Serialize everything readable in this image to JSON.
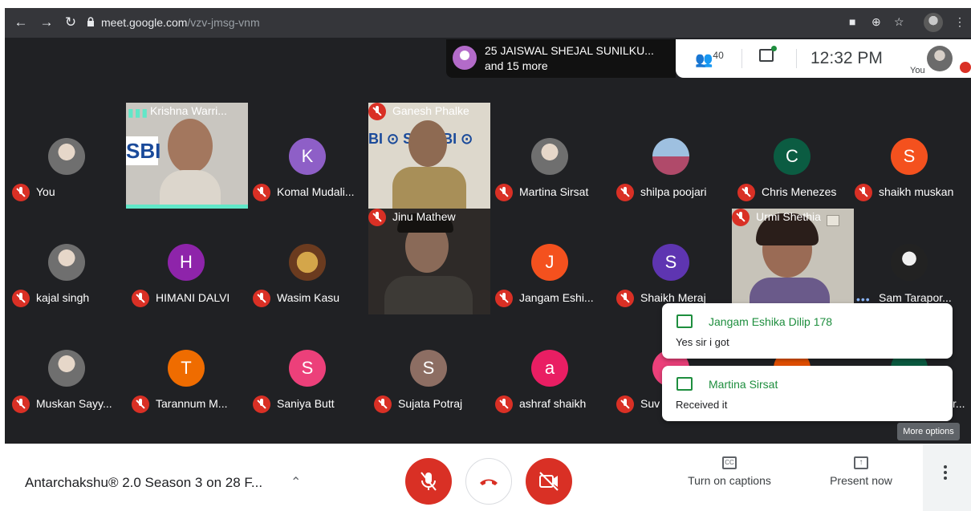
{
  "browser": {
    "url_host": "meet.google.com",
    "url_path": "/vzv-jmsg-vnm"
  },
  "topbar": {
    "presenter_line1": "25 JAISWAL SHEJAL SUNILKU...",
    "presenter_line2": "and 15 more",
    "participant_count": "40",
    "time": "12:32 PM",
    "you_label": "You"
  },
  "tiles": [
    {
      "label": "You"
    },
    {
      "label": "Krishna Warri..."
    },
    {
      "label": "Komal Mudali...",
      "initial": "K",
      "color": "#8e5fc7"
    },
    {
      "label": "Ganesh Phalke"
    },
    {
      "label": "Martina Sirsat"
    },
    {
      "label": "shilpa poojari"
    },
    {
      "label": "Chris Menezes",
      "initial": "C",
      "color": "#0b5c42"
    },
    {
      "label": "shaikh muskan",
      "initial": "S",
      "color": "#f4511e"
    },
    {
      "label": "kajal singh"
    },
    {
      "label": "HIMANI DALVI",
      "initial": "H",
      "color": "#8e24aa"
    },
    {
      "label": "Wasim Kasu"
    },
    {
      "label": "Jinu Mathew"
    },
    {
      "label": "Jangam Eshi...",
      "initial": "J",
      "color": "#f4511e"
    },
    {
      "label": "Shaikh Meraj",
      "initial": "S",
      "color": "#5e35b1"
    },
    {
      "label": "Urmi Shethia"
    },
    {
      "label": "Sam Tarapor..."
    },
    {
      "label": "Muskan Sayy..."
    },
    {
      "label": "Tarannum M...",
      "initial": "T",
      "color": "#ef6c00"
    },
    {
      "label": "Saniya Butt",
      "initial": "S",
      "color": "#ec407a"
    },
    {
      "label": "Sujata Potraj",
      "initial": "S",
      "color": "#8d6e63"
    },
    {
      "label": "ashraf shaikh",
      "initial": "a",
      "color": "#e91e63"
    },
    {
      "label": "Suv"
    },
    {
      "label": "r..."
    }
  ],
  "toasts": [
    {
      "name": "Jangam Eshika Dilip 178",
      "message": "Yes sir i got"
    },
    {
      "name": "Martina Sirsat",
      "message": "Received it"
    }
  ],
  "tooltip": "More options",
  "bottombar": {
    "meeting_title": "Antarchakshu® 2.0 Season 3 on 28 F...",
    "captions_label": "Turn on captions",
    "captions_icon": "CC",
    "present_label": "Present now"
  }
}
